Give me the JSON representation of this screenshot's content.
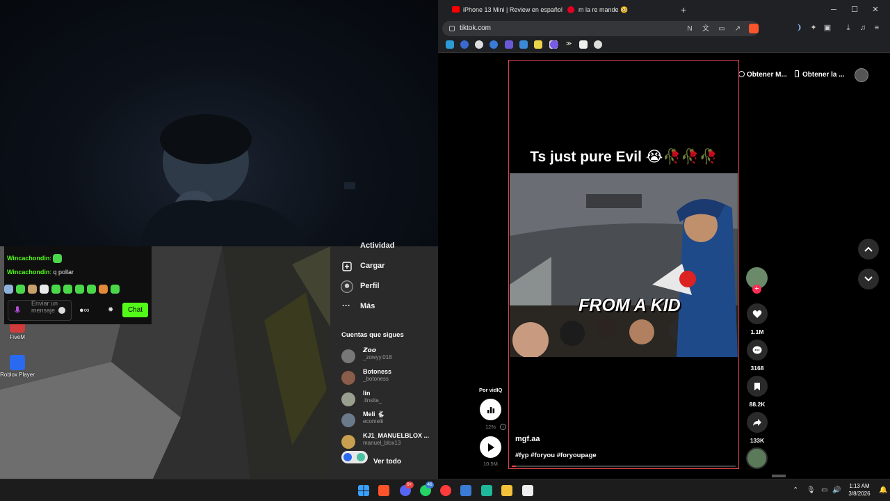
{
  "desktop": {
    "icons": [
      {
        "label": "FiveM"
      },
      {
        "label": "Roblox Player"
      }
    ]
  },
  "chat": {
    "messages": [
      {
        "user": "Wincachondin",
        "text": ""
      },
      {
        "user": "Wincachondin",
        "text": "q pollar"
      }
    ],
    "input_placeholder": "Enviar un mensaje",
    "send_label": "Chat"
  },
  "browser": {
    "tabs": [
      {
        "title": "iPhone 13 Mini | Review en español"
      },
      {
        "title": "m la re mande 🥺"
      }
    ],
    "new_tab": "+",
    "url": "tiktok.com",
    "window_controls": {
      "minimize": "─",
      "maximize": "☐",
      "close": "✕"
    }
  },
  "tiktok": {
    "sidebar": {
      "items": [
        {
          "label": "Actividad",
          "icon": "activity-icon"
        },
        {
          "label": "Cargar",
          "icon": "upload-icon"
        },
        {
          "label": "Perfil",
          "icon": "profile-icon"
        },
        {
          "label": "Más",
          "icon": "more-icon"
        }
      ],
      "following_title": "Cuentas que sigues",
      "following": [
        {
          "name": "𝙕𝙤𝙤",
          "handle": "_zowyy.018"
        },
        {
          "name": "Botoness",
          "handle": "_botoness"
        },
        {
          "name": "lin",
          "handle": ".linsita_"
        },
        {
          "name": "Meli 🐇",
          "handle": "ecomelii"
        },
        {
          "name": "KJ1_MANUELBLOX ...",
          "handle": "manuel_blox13"
        }
      ],
      "see_all": "Ver todo"
    },
    "top_chips": [
      {
        "label": "Obtener M..."
      },
      {
        "label": "Obtener la ..."
      }
    ],
    "video": {
      "caption": "Ts just pure Evil 😭🥀🥀🥀",
      "overlay_text": "FROM A KID",
      "author": "mgf.aa",
      "hashtags": "#fyp #foryou #foryoupage",
      "progress": 0.02
    },
    "actions": {
      "likes": "1.1M",
      "comments": "3168",
      "saves": "88.2K",
      "shares": "133K"
    },
    "vidiq": {
      "label": "Por vidIQ",
      "percent": "12%",
      "views": "10.5M"
    }
  },
  "taskbar": {
    "time": "1:13 AM",
    "date": "3/8/2026",
    "discord_badge": "9+",
    "whatsapp_badge": "46"
  },
  "colors": {
    "kick_green": "#53fc18",
    "video_border": "#e0424d",
    "browser_chrome": "#202124"
  }
}
